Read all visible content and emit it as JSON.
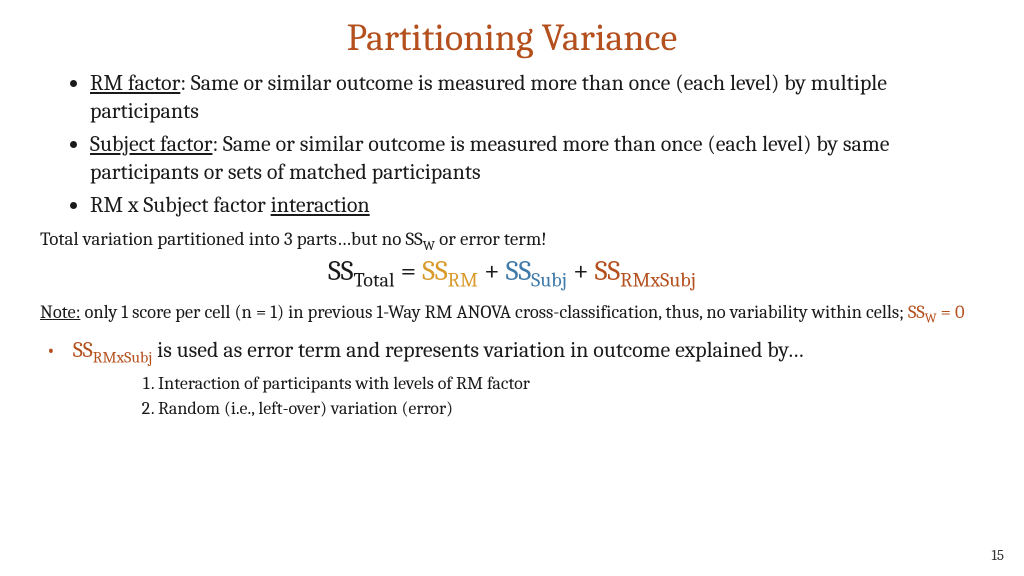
{
  "title": "Partitioning Variance",
  "bullets": {
    "b1_label": "RM factor",
    "b1_rest": ": Same or similar outcome is measured more than once (each level) by multiple participants",
    "b2_label": "Subject factor",
    "b2_rest": ": Same or similar outcome is measured more than once (each level) by same participants or sets of matched participants",
    "b3_pre": "RM x Subject factor ",
    "b3_label": "interaction"
  },
  "partition": {
    "pre": "Total variation partitioned into 3 parts…but no SS",
    "sub": "W",
    "post": " or error term!"
  },
  "equation": {
    "ss": "SS",
    "total_sub": "Total",
    "eq": " = ",
    "rm_sub": "RM",
    "plus": " + ",
    "subj_sub": "Subj",
    "int_sub": "RMxSubj"
  },
  "note": {
    "label": "Note:",
    "rest_a": " only 1 score per cell (n = 1) in previous 1-Way RM ANOVA cross-classification, thus, no variability within cells; ",
    "ssw": "SS",
    "ssw_sub": "W",
    "ssw_eq": " = 0"
  },
  "explain": {
    "ss": "SS",
    "ss_sub": "RMxSubj",
    "rest": " is used as error term and represents variation in outcome explained by…",
    "item1": "Interaction of participants with levels of RM factor",
    "item2": "Random (i.e., left-over) variation (error)"
  },
  "pagenum": "15"
}
